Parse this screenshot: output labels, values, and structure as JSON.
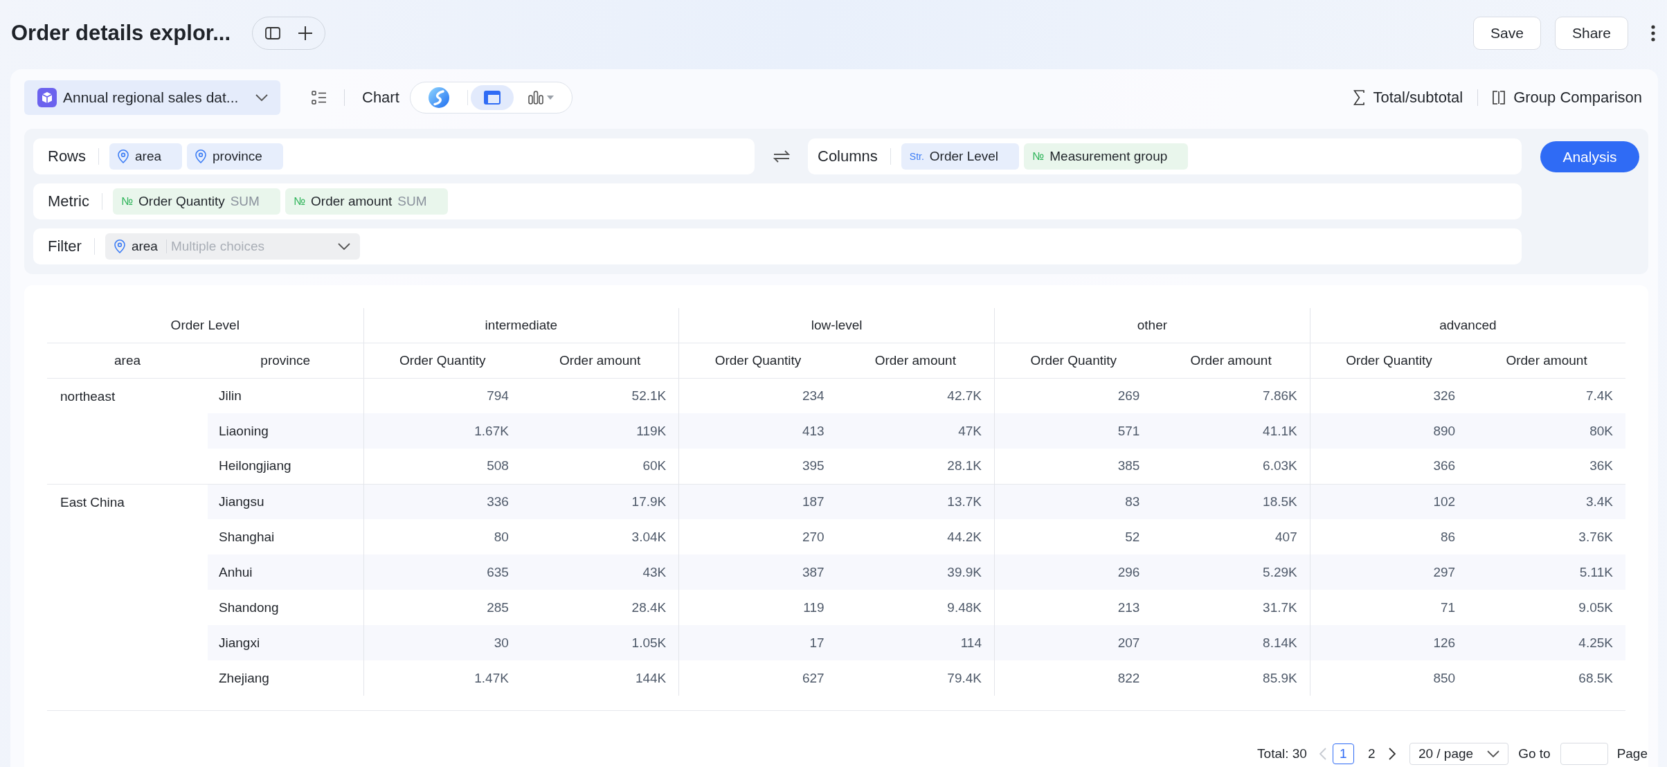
{
  "header": {
    "title": "Order details explor...",
    "buttons": [
      "Save",
      "Share"
    ]
  },
  "toolbar": {
    "dataset": "Annual regional sales dat...",
    "chart_label": "Chart",
    "chart_types": [
      {
        "kind": "logo",
        "selected": false
      },
      {
        "kind": "table",
        "selected": true
      },
      {
        "kind": "bar",
        "selected": false
      }
    ],
    "actions": [
      {
        "kind": "sum",
        "label": "Total/subtotal"
      },
      {
        "kind": "compare",
        "label": "Group Comparison"
      }
    ]
  },
  "config": {
    "rows": {
      "label": "Rows",
      "fields": [
        {
          "kind": "geo",
          "name": "area"
        },
        {
          "kind": "geo",
          "name": "province"
        }
      ]
    },
    "columns": {
      "label": "Columns",
      "fields": [
        {
          "kind": "str",
          "tag": "Str.",
          "name": "Order Level"
        },
        {
          "kind": "num",
          "tag": "№",
          "name": "Measurement group"
        }
      ]
    },
    "metric": {
      "label": "Metric",
      "fields": [
        {
          "kind": "num",
          "tag": "№",
          "name": "Order Quantity",
          "aggregation": "SUM"
        },
        {
          "kind": "num",
          "tag": "№",
          "name": "Order amount",
          "aggregation": "SUM"
        }
      ]
    },
    "filter": {
      "label": "Filter",
      "fields": [
        {
          "kind": "geo",
          "name": "area",
          "placeholder": "Multiple choices"
        }
      ]
    },
    "analysis_button": "Analysis"
  },
  "table": {
    "corner": "Order Level",
    "row_headers": [
      "area",
      "province"
    ],
    "column_groups": [
      {
        "name": "intermediate",
        "measures": [
          "Order Quantity",
          "Order amount"
        ]
      },
      {
        "name": "low-level",
        "measures": [
          "Order Quantity",
          "Order amount"
        ]
      },
      {
        "name": "other",
        "measures": [
          "Order Quantity",
          "Order amount"
        ]
      },
      {
        "name": "advanced",
        "measures": [
          "Order Quantity",
          "Order amount"
        ]
      }
    ],
    "row_groups": [
      {
        "area": "northeast",
        "rows": [
          {
            "province": "Jilin",
            "values": [
              "794",
              "52.1K",
              "234",
              "42.7K",
              "269",
              "7.86K",
              "326",
              "7.4K"
            ]
          },
          {
            "province": "Liaoning",
            "values": [
              "1.67K",
              "119K",
              "413",
              "47K",
              "571",
              "41.1K",
              "890",
              "80K"
            ]
          },
          {
            "province": "Heilongjiang",
            "values": [
              "508",
              "60K",
              "395",
              "28.1K",
              "385",
              "6.03K",
              "366",
              "36K"
            ]
          }
        ]
      },
      {
        "area": "East China",
        "rows": [
          {
            "province": "Jiangsu",
            "values": [
              "336",
              "17.9K",
              "187",
              "13.7K",
              "83",
              "18.5K",
              "102",
              "3.4K"
            ]
          },
          {
            "province": "Shanghai",
            "values": [
              "80",
              "3.04K",
              "270",
              "44.2K",
              "52",
              "407",
              "86",
              "3.76K"
            ]
          },
          {
            "province": "Anhui",
            "values": [
              "635",
              "43K",
              "387",
              "39.9K",
              "296",
              "5.29K",
              "297",
              "5.11K"
            ]
          },
          {
            "province": "Shandong",
            "values": [
              "285",
              "28.4K",
              "119",
              "9.48K",
              "213",
              "31.7K",
              "71",
              "9.05K"
            ]
          },
          {
            "province": "Jiangxi",
            "values": [
              "30",
              "1.05K",
              "17",
              "114",
              "207",
              "8.14K",
              "126",
              "4.25K"
            ]
          },
          {
            "province": "Zhejiang",
            "values": [
              "1.47K",
              "144K",
              "627",
              "79.4K",
              "822",
              "85.9K",
              "850",
              "68.5K"
            ]
          }
        ]
      }
    ]
  },
  "pagination": {
    "total": "Total: 30",
    "prev": {
      "disabled": true
    },
    "pages": [
      {
        "label": "1",
        "selected": true
      },
      {
        "label": "2",
        "selected": false
      }
    ],
    "next": {
      "disabled": false
    },
    "page_size": "20 / page",
    "goto": "Go to",
    "unit": "Page"
  }
}
